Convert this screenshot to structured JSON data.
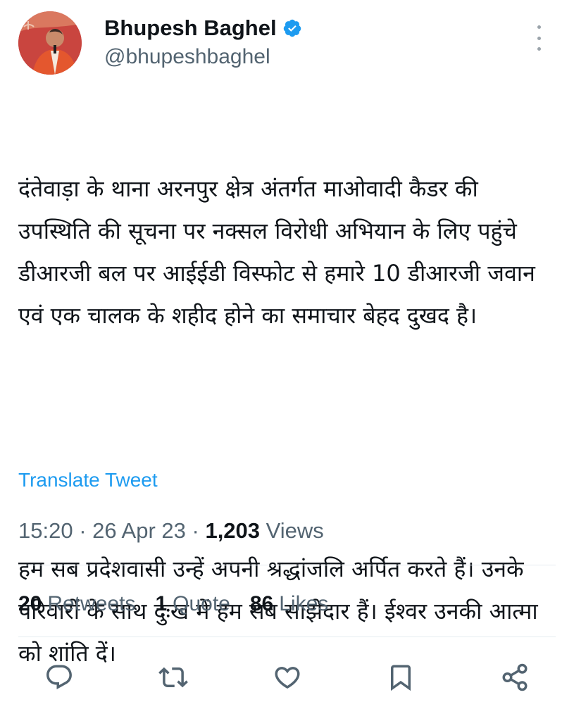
{
  "user": {
    "display_name": "Bhupesh Baghel",
    "handle": "@bhupeshbaghel",
    "verified": true,
    "verified_color": "#1d9bf0"
  },
  "tweet": {
    "paragraphs": [
      "दंतेवाड़ा के थाना अरनपुर क्षेत्र अंतर्गत माओवादी कैडर की उपस्थिति की सूचना पर नक्सल विरोधी अभियान के लिए पहुंचे डीआरजी बल पर आईईडी विस्फोट से हमारे 10 डीआरजी जवान एवं एक चालक के शहीद होने का समाचार बेहद दुखद है।",
      "हम सब प्रदेशवासी उन्हें अपनी श्रद्धांजलि अर्पित करते हैं। उनके परिवारों के साथ दुःख में हम सब साझेदार हैं। ईश्वर उनकी आत्मा को शांति दें।"
    ],
    "translate_label": "Translate Tweet"
  },
  "meta": {
    "time": "15:20",
    "separator": "·",
    "date": "26 Apr 23",
    "views_count": "1,203",
    "views_label": "Views"
  },
  "stats": {
    "retweets_count": "20",
    "retweets_label": "Retweets",
    "quotes_count": "1",
    "quotes_label": "Quote",
    "likes_count": "86",
    "likes_label": "Likes"
  },
  "actions": {
    "icons": [
      "reply-icon",
      "retweet-icon",
      "like-icon",
      "bookmark-icon",
      "share-icon"
    ],
    "icon_color": "#536471"
  },
  "theme": {
    "link_color": "#1d9bf0",
    "secondary_text": "#536471",
    "divider_color": "#e6ecf0"
  }
}
